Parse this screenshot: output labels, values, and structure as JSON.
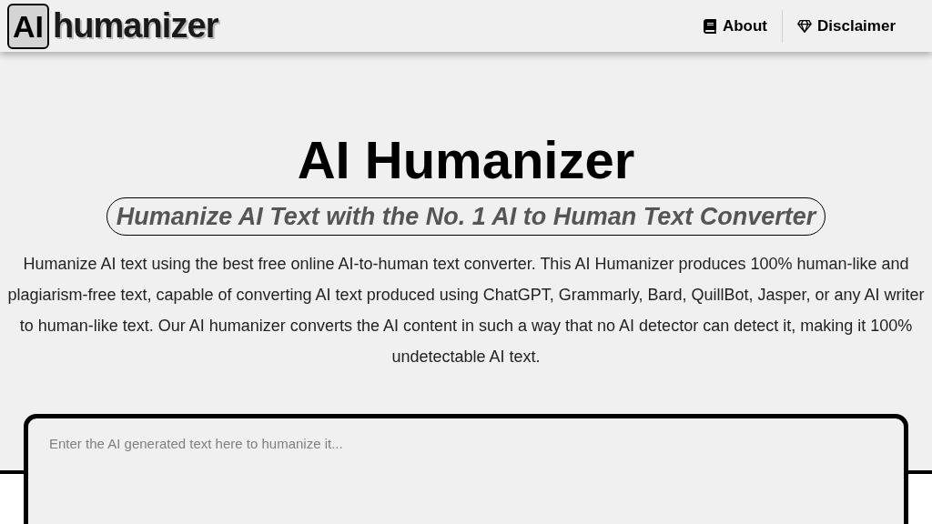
{
  "logo": {
    "badge": "AI",
    "wordmark": "humanizer"
  },
  "nav": [
    {
      "label": "About",
      "kind": "book"
    },
    {
      "label": "Disclaimer",
      "kind": "gem"
    }
  ],
  "hero": {
    "title": "AI Humanizer",
    "subtitle": "Humanize AI Text with the No. 1 AI to Human Text Converter",
    "description": "Humanize AI text using the best free online AI-to-human text converter. This AI Humanizer produces 100% human-like and plagiarism-free text, capable of converting AI text produced using ChatGPT, Grammarly, Bard, QuillBot, Jasper, or any AI writer to human-like text. Our AI humanizer converts the AI content in such a way that no AI detector can detect it, making it 100% undetectable AI text."
  },
  "editor": {
    "placeholder": "Enter the AI generated text here to humanize it..."
  }
}
